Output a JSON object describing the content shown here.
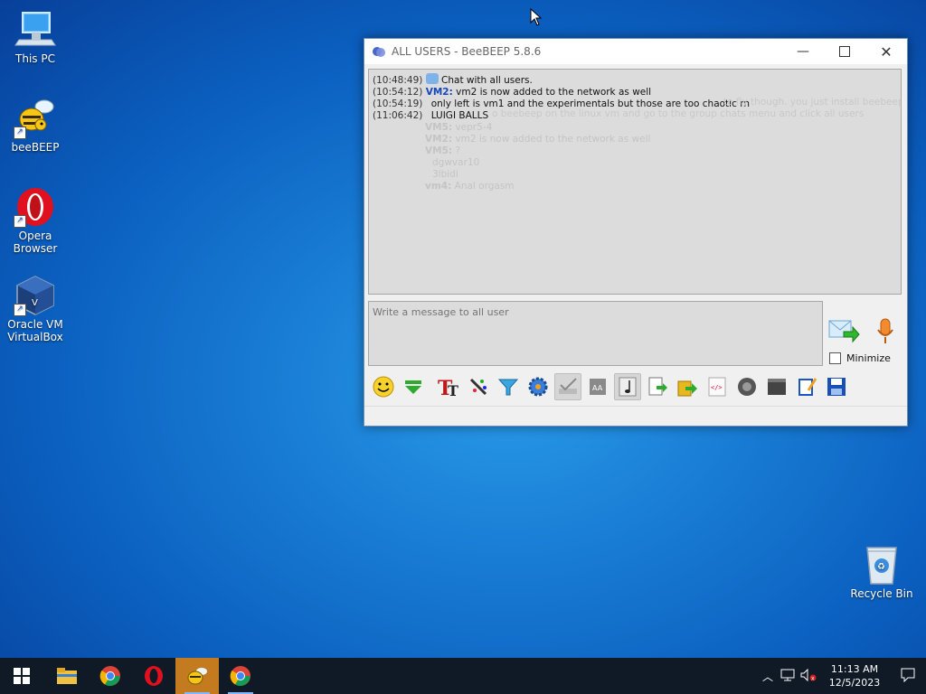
{
  "desktop": {
    "icons": [
      {
        "label": "This PC"
      },
      {
        "label": "beeBEEP"
      },
      {
        "label": "Opera Browser"
      },
      {
        "label": "Oracle VM VirtualBox"
      },
      {
        "label": "Recycle Bin"
      }
    ]
  },
  "window": {
    "title": "ALL USERS - BeeBEEP 5.8.6",
    "messages": [
      {
        "time": "(10:48:49)",
        "user": "",
        "text": " Chat with all users."
      },
      {
        "time": "(10:54:12)",
        "user": "VM2:",
        "text": " vm2 is now added to the network as well"
      },
      {
        "time": "(10:54:19)",
        "user": "",
        "text": "only left is vm1 and the experimentals but those are too chaotic rn"
      },
      {
        "time": "(11:06:42)",
        "user": "",
        "text": "LUIGI BALLS"
      }
    ],
    "ghost_lines": [
      {
        "user": "VM5:",
        "text": "vepr5-4"
      },
      {
        "user": "VM2:",
        "text": "vm2 is now added to the network as well"
      },
      {
        "user": "VM5:",
        "text": "?"
      },
      {
        "user": "",
        "text": "dgwvar10"
      },
      {
        "user": "",
        "text": "3lbidi"
      },
      {
        "user": "vm4:",
        "text": "Anal orgasm"
      }
    ],
    "ghost_right_1": "to fly though. you just install beebeep",
    "ghost_right_2": "o beebeep on the linux vm and go to the group chats menu and click all users",
    "input_placeholder": "Write a message to all user",
    "minimize_label": "Minimize"
  },
  "taskbar": {
    "time": "11:13 AM",
    "date": "12/5/2023"
  }
}
